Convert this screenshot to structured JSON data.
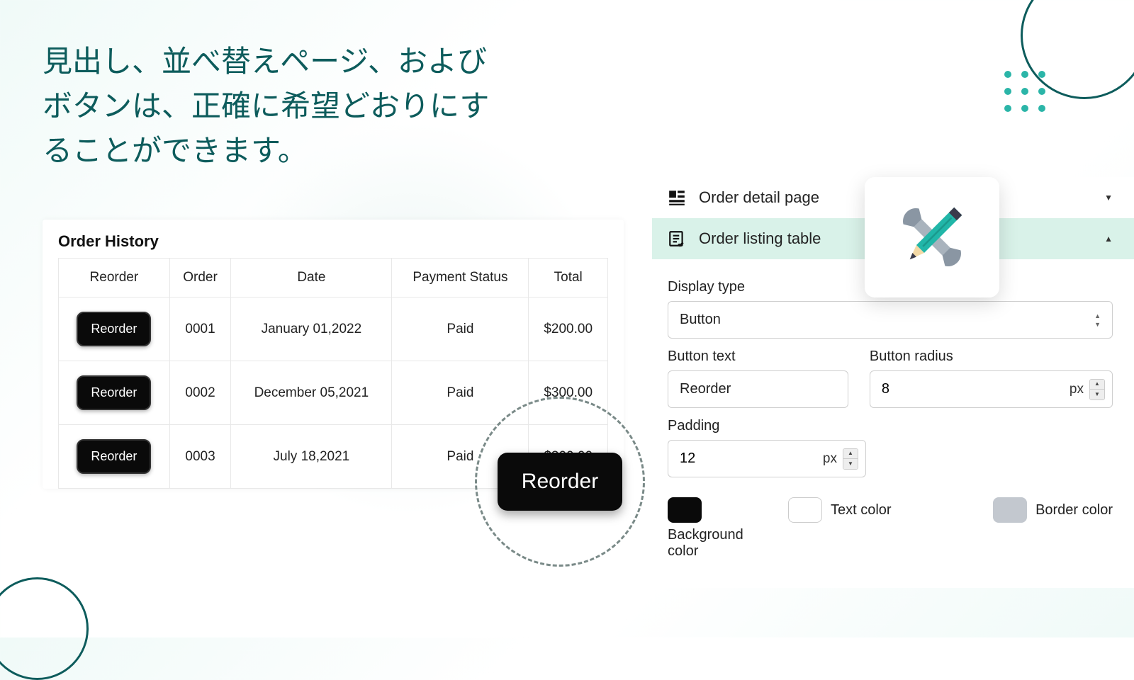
{
  "heading": "見出し、並べ替えページ、およびボタンは、正確に希望どおりにすることができます。",
  "order_history": {
    "title": "Order History",
    "columns": [
      "Reorder",
      "Order",
      "Date",
      "Payment Status",
      "Total"
    ],
    "reorder_label": "Reorder",
    "rows": [
      {
        "order": "0001",
        "date": "January 01,2022",
        "status": "Paid",
        "total": "$200.00"
      },
      {
        "order": "0002",
        "date": "December 05,2021",
        "status": "Paid",
        "total": "$300.00"
      },
      {
        "order": "0003",
        "date": "July 18,2021",
        "status": "Paid",
        "total": "$300.00"
      }
    ]
  },
  "zoom_button_label": "Reorder",
  "panel": {
    "nav": {
      "detail": "Order detail page",
      "listing": "Order listing table"
    },
    "display_type_label": "Display type",
    "display_type_value": "Button",
    "button_text_label": "Button text",
    "button_text_value": "Reorder",
    "button_radius_label": "Button radius",
    "button_radius_value": "8",
    "button_radius_unit": "px",
    "padding_label": "Padding",
    "padding_value": "12",
    "padding_unit": "px",
    "bg_color_label": "Background color",
    "text_color_label": "Text color",
    "border_color_label": "Border color",
    "colors": {
      "background": "#0a0a0a",
      "text": "#ffffff",
      "border": "#c3c8cf"
    }
  }
}
